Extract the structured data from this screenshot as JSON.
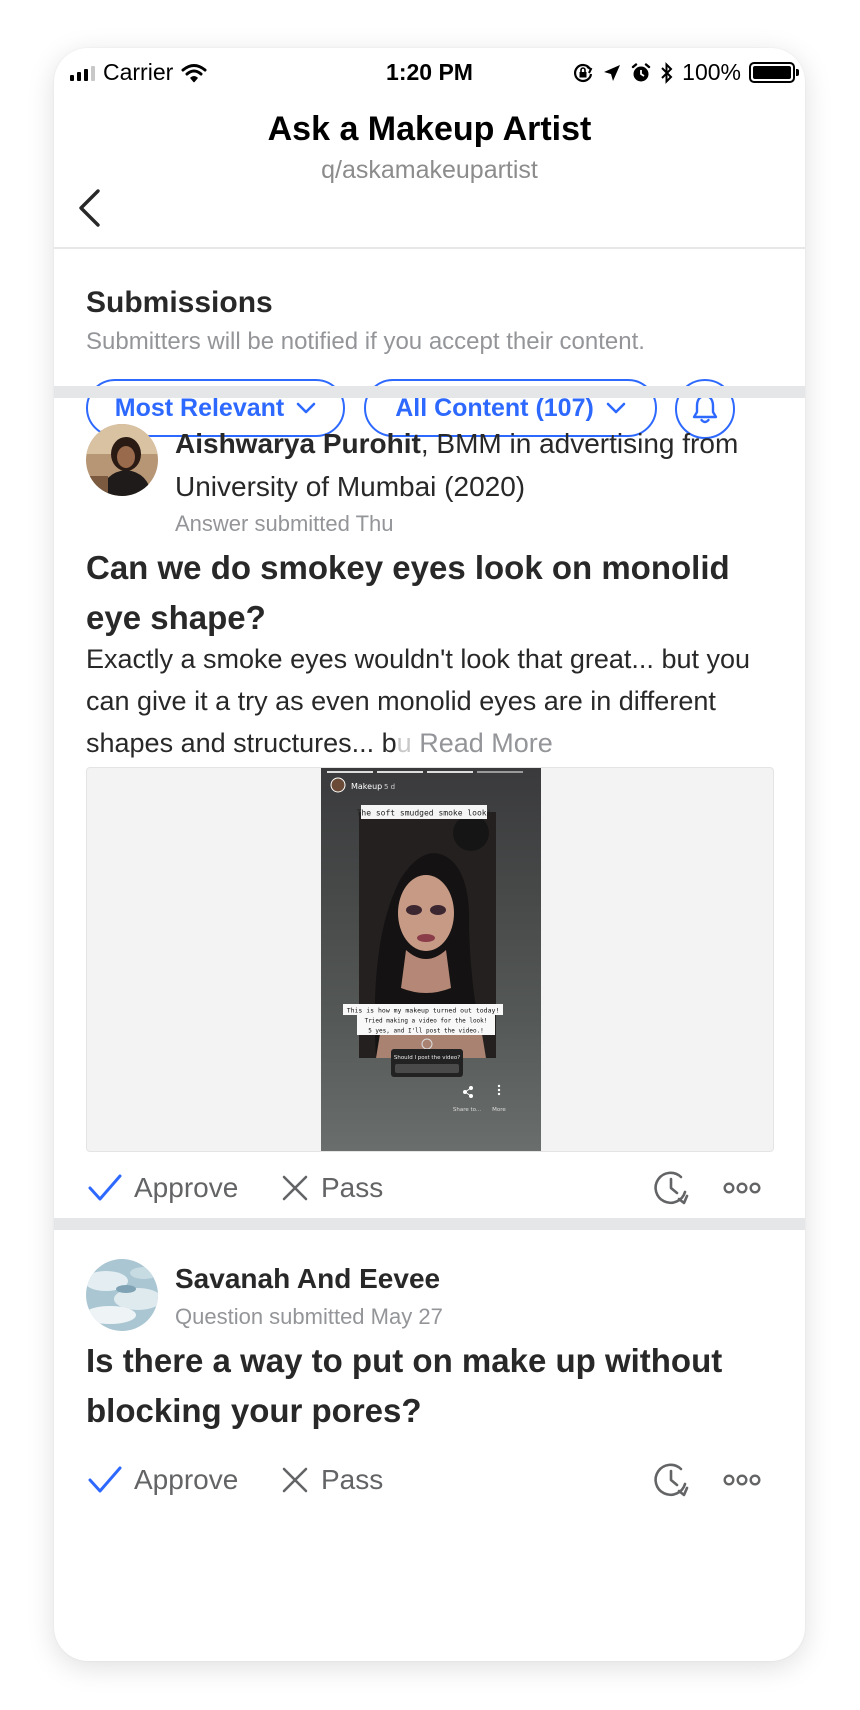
{
  "status_bar": {
    "carrier": "Carrier",
    "time": "1:20 PM",
    "battery": "100%"
  },
  "header": {
    "title": "Ask a Makeup Artist",
    "subtitle": "q/askamakeupartist"
  },
  "submissions": {
    "title": "Submissions",
    "description": "Submitters will be notified if you accept their content.",
    "sort_label": "Most Relevant",
    "filter_label": "All Content (107)"
  },
  "actions": {
    "approve": "Approve",
    "pass": "Pass"
  },
  "posts": [
    {
      "author_name": "Aishwarya Purohit",
      "author_credential": ", BMM in advertising from University of Mumbai (2020)",
      "meta": "Answer submitted Thu",
      "title": "Can we do smokey eyes look on monolid eye shape?",
      "excerpt": "Exactly a smoke eyes wouldn't look that great... but you can give it a try as even monolid eyes are in different shapes and structures... b",
      "excerpt_fade": "u",
      "read_more": "Read More",
      "image": {
        "story_user": "Makeup",
        "story_age": "5 d",
        "caption_top": "The soft smudged smoke look!",
        "caption_1": "This is how my makeup turned out today!",
        "caption_2": "Tried making a video for the look!",
        "caption_3": "5 yes, and I'll post the video.!",
        "poll_question": "Should I post the video?",
        "share_label": "Share to...",
        "more_label": "More"
      }
    },
    {
      "author_name": "Savanah And Eevee",
      "meta": "Question submitted May 27",
      "title": "Is there a way to put on make up without blocking your pores?"
    }
  ],
  "colors": {
    "accent": "#2e69ff",
    "text": "#282829",
    "muted": "#939598",
    "divider": "#e4e6e8"
  },
  "icons": [
    "signal-icon",
    "wifi-icon",
    "orientation-lock-icon",
    "location-icon",
    "alarm-icon",
    "bluetooth-icon",
    "battery-icon",
    "back-chevron-icon",
    "chevron-down-icon",
    "bell-icon",
    "check-icon",
    "close-icon",
    "schedule-icon",
    "more-icon"
  ]
}
